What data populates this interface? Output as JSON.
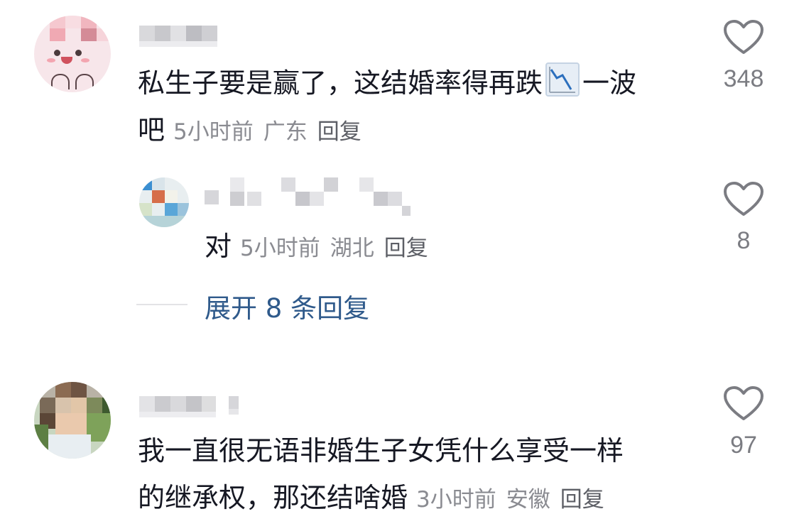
{
  "comments": [
    {
      "text_line1": "私生子要是赢了，这结婚率得再跌",
      "text_line1_tail": "一波",
      "text_line2": "吧",
      "time": "5小时前",
      "region": "广东",
      "reply_label": "回复",
      "likes": "348",
      "reply": {
        "text": "对",
        "time": "5小时前",
        "region": "湖北",
        "reply_label": "回复",
        "likes": "8"
      },
      "expand_label": "展开 8 条回复"
    },
    {
      "text_line1": "我一直很无语非婚生子女凭什么享受一样",
      "text_line2": "的继承权，那还结啥婚",
      "time": "3小时前",
      "region": "安徽",
      "reply_label": "回复",
      "likes": "97"
    }
  ],
  "icons": {
    "like": "heart-outline-icon",
    "emoji": "chart-decreasing-emoji"
  },
  "colors": {
    "text": "#161823",
    "meta": "#8a8b91",
    "link": "#2f5a8b",
    "icon": "#7b7c82"
  }
}
